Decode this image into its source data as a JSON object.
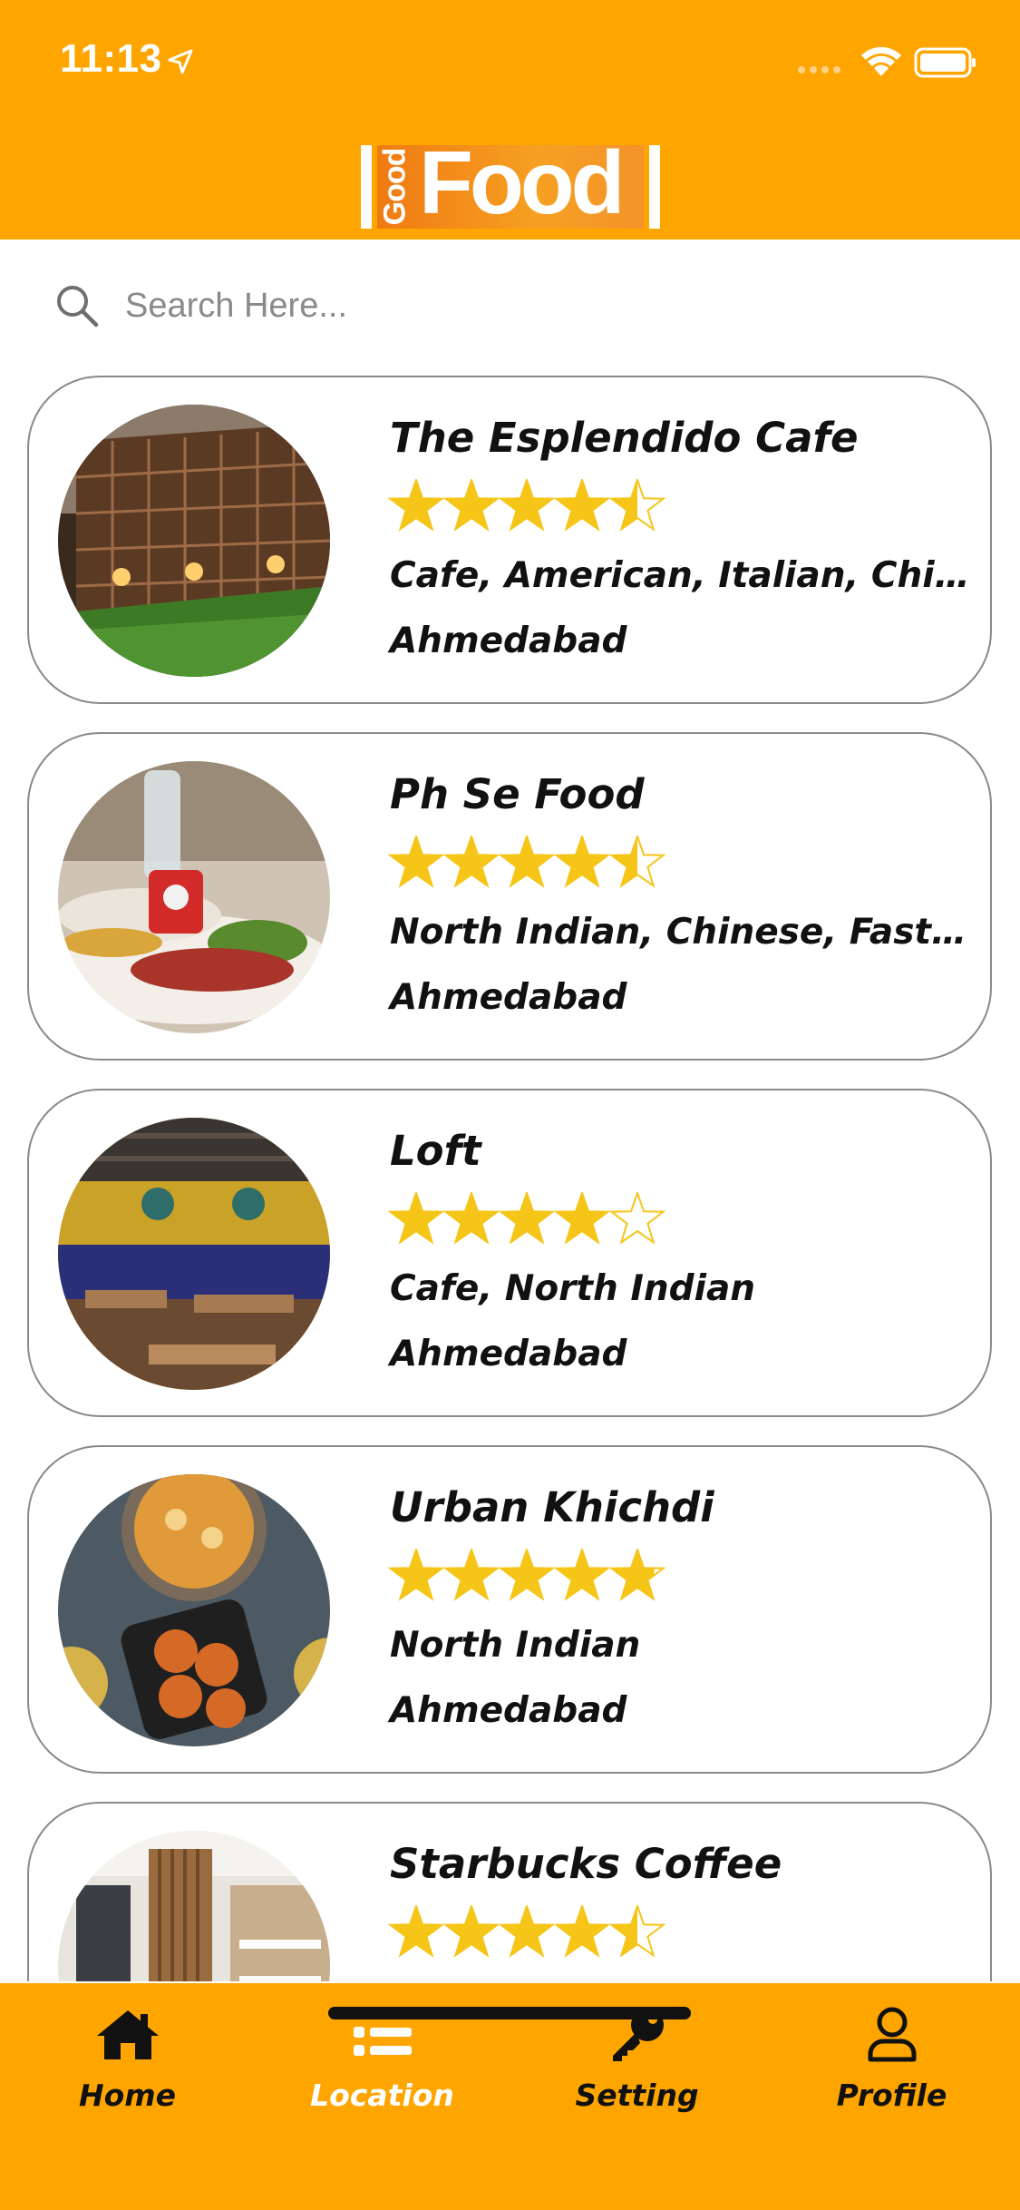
{
  "status_bar": {
    "time": "11:13"
  },
  "header": {
    "logo_good": "Good",
    "logo_food": "Food"
  },
  "search": {
    "placeholder": "Search Here..."
  },
  "colors": {
    "primary": "#FFA500",
    "star": "#F5C518",
    "active_tab_text": "#FFFFFF"
  },
  "restaurants": [
    {
      "name": "The Esplendido Cafe",
      "rating": 4.5,
      "cuisine": "Cafe, American, Italian, Chinese, Continental",
      "city": "Ahmedabad",
      "image": "garden-cafe-photo"
    },
    {
      "name": "Ph Se Food",
      "rating": 4.5,
      "cuisine": "North Indian, Chinese, Fast Food",
      "city": "Ahmedabad",
      "image": "food-platter-photo"
    },
    {
      "name": "Loft",
      "rating": 4,
      "cuisine": "Cafe, North Indian",
      "city": "Ahmedabad",
      "image": "restaurant-interior-photo"
    },
    {
      "name": "Urban Khichdi",
      "rating": 4.8,
      "cuisine": "North Indian",
      "city": "Ahmedabad",
      "image": "khichdi-dishes-photo"
    },
    {
      "name": "Starbucks Coffee",
      "rating": 4.5,
      "cuisine": "",
      "city": "",
      "image": "coffee-shop-photo"
    }
  ],
  "tabs": [
    {
      "label": "Home",
      "icon": "home-icon",
      "active": false
    },
    {
      "label": "Location",
      "icon": "list-icon",
      "active": true
    },
    {
      "label": "Setting",
      "icon": "key-icon",
      "active": false
    },
    {
      "label": "Profile",
      "icon": "user-icon",
      "active": false
    }
  ]
}
